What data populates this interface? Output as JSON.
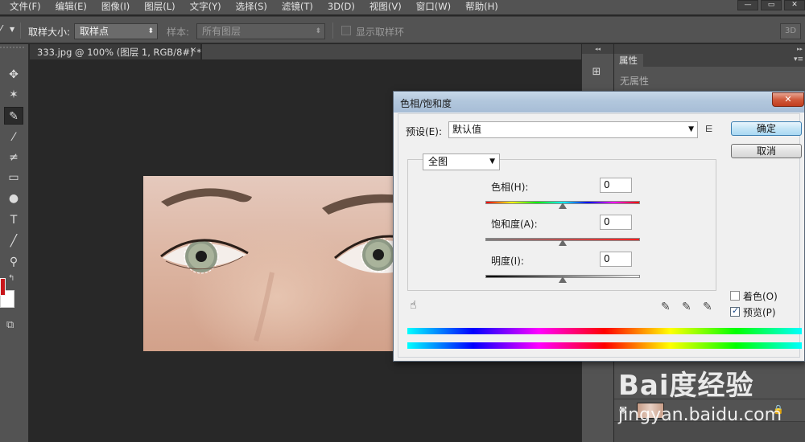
{
  "menubar": {
    "items": [
      "文件(F)",
      "编辑(E)",
      "图像(I)",
      "图层(L)",
      "文字(Y)",
      "选择(S)",
      "滤镜(T)",
      "3D(D)",
      "视图(V)",
      "窗口(W)",
      "帮助(H)"
    ],
    "window_controls": [
      "—",
      "▭",
      "✕"
    ]
  },
  "options_bar": {
    "sample_size_label": "取样大小:",
    "sample_size_value": "取样点",
    "sample_label": "样本:",
    "sample_value": "所有图层",
    "show_ring_label": "显示取样环",
    "btn_3d": "3D"
  },
  "document": {
    "tab_title": "333.jpg @ 100% (图层 1, RGB/8#) *",
    "tab_close": "×"
  },
  "properties_panel": {
    "tab_label": "属性",
    "empty_text": "无属性"
  },
  "dialog": {
    "title": "色相/饱和度",
    "close": "✕",
    "preset_label": "预设(E):",
    "preset_value": "默认值",
    "ok": "确定",
    "cancel": "取消",
    "channel_value": "全图",
    "hue_label": "色相(H):",
    "hue_value": "0",
    "saturation_label": "饱和度(A):",
    "saturation_value": "0",
    "lightness_label": "明度(I):",
    "lightness_value": "0",
    "colorize_label": "着色(O)",
    "colorize_checked": false,
    "preview_label": "预览(P)",
    "preview_checked": true,
    "slider_positions": {
      "hue": 0.5,
      "saturation": 0.5,
      "lightness": 0.5
    }
  },
  "watermark": {
    "logo": "Bai度经验",
    "url": "jingyan.baidu.com"
  },
  "colors": {
    "foreground": "#c8161b",
    "background": "#ffffff",
    "app_bg": "#535353",
    "canvas_bg": "#282828"
  },
  "icons": {
    "tools": [
      "move-icon",
      "magic-wand-icon",
      "eyedropper-icon",
      "brush-icon",
      "history-brush-icon",
      "gradient-icon",
      "dodge-icon",
      "type-icon",
      "line-icon",
      "zoom-icon"
    ]
  }
}
